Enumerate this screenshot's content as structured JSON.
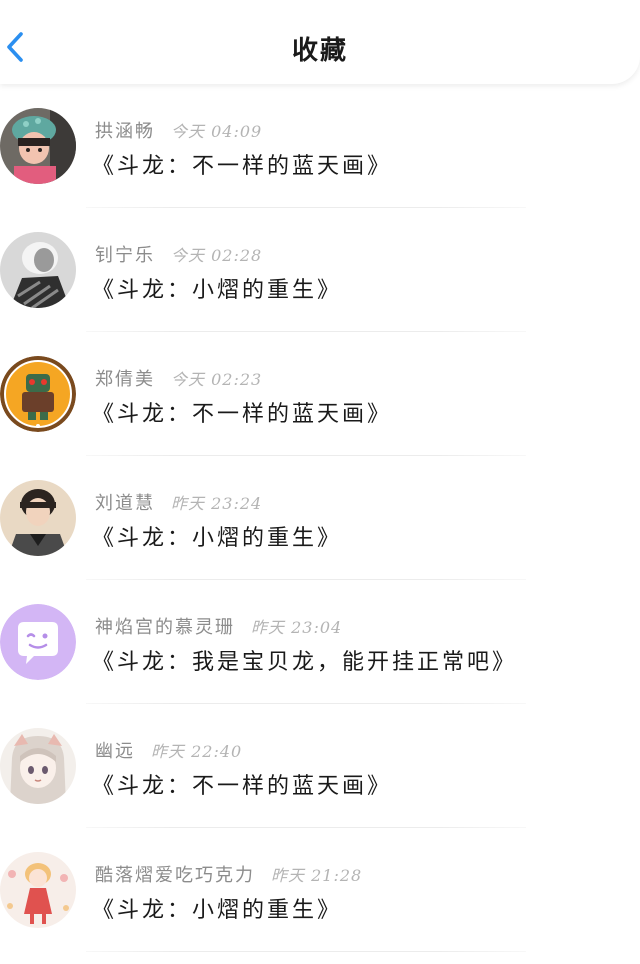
{
  "header": {
    "title": "收藏",
    "back_icon": "chevron-left-icon",
    "accent_color": "#2b8ff0"
  },
  "favorites": [
    {
      "user": "拱涵畅",
      "time": "今天 04:09",
      "title": "《斗龙：不一样的蓝天画》",
      "avatar": "child-photo"
    },
    {
      "user": "钊宁乐",
      "time": "今天 02:28",
      "title": "《斗龙：小熠的重生》",
      "avatar": "grayscale-photo"
    },
    {
      "user": "郑倩美",
      "time": "今天 02:23",
      "title": "《斗龙：不一样的蓝天画》",
      "avatar": "orange-badge"
    },
    {
      "user": "刘道慧",
      "time": "昨天 23:24",
      "title": "《斗龙：小熠的重生》",
      "avatar": "portrait-photo"
    },
    {
      "user": "神焰宫的慕灵珊",
      "time": "昨天 23:04",
      "title": "《斗龙：我是宝贝龙，能开挂正常吧》",
      "avatar": "purple-chat-bubble"
    },
    {
      "user": "幽远",
      "time": "昨天 22:40",
      "title": "《斗龙：不一样的蓝天画》",
      "avatar": "anime-girl"
    },
    {
      "user": "酷落熠爱吃巧克力",
      "time": "昨天 21:28",
      "title": "《斗龙：小熠的重生》",
      "avatar": "pink-cartoon"
    }
  ]
}
